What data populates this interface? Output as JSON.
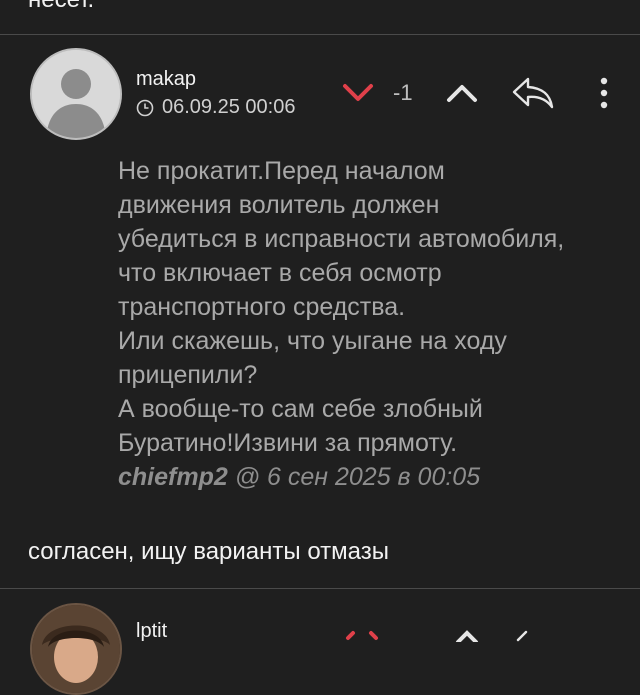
{
  "previous_comment": {
    "tail_text": "несет."
  },
  "comment": {
    "username": "makap",
    "timestamp": "06.09.25 00:06",
    "score": "-1",
    "icons": {
      "downvote": "chevron-down-icon",
      "upvote": "chevron-up-icon",
      "reply": "reply-arrow-icon",
      "menu": "more-vert-icon",
      "clock": "clock-icon",
      "avatar": "default-user-avatar"
    },
    "colors": {
      "downvote_active": "#e0404a"
    },
    "quote": {
      "lines": [
        "Не прокатит.Перед началом",
        "движения волитель должен",
        "убедиться в исправности автомобиля,",
        "что включает в себя осмотр",
        "транспортного средства.",
        "Или скажешь, что уыгане на ходу",
        "прицепили?",
        "А вообще-то сам себе злобный",
        "Буратино!Извини за прямоту."
      ],
      "author": "chiefmp2",
      "signature_rest": " @ 6 сен 2025 в 00:05"
    },
    "reply_text": "согласен, ищу варианты отмазы"
  },
  "next_comment": {
    "username": "lptit"
  }
}
